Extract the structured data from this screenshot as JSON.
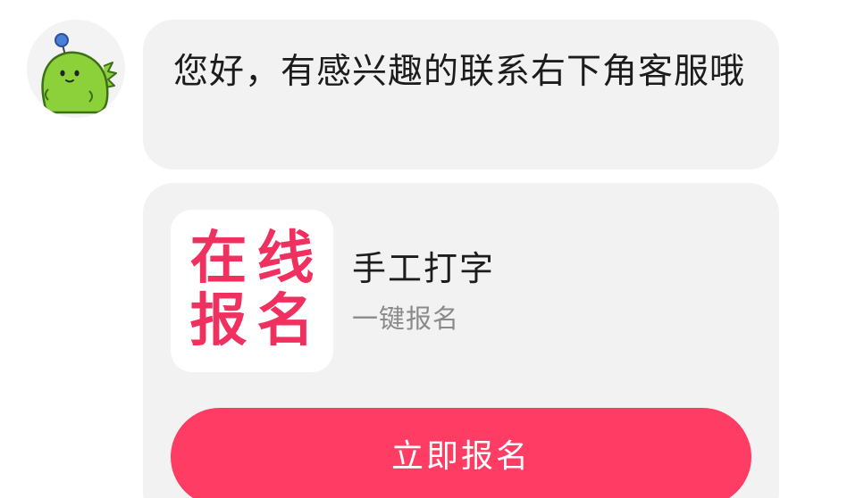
{
  "message": {
    "text": "您好，有感兴趣的联系右下角客服哦"
  },
  "card": {
    "logo_chars": [
      "在",
      "线",
      "报",
      "名"
    ],
    "title": "手工打字",
    "subtitle": "一键报名",
    "button_label": "立即报名"
  },
  "colors": {
    "accent": "#ff3d64",
    "logo_red": "#f0305f",
    "bubble_bg": "#f2f2f2",
    "avatar_green": "#8cd13a"
  },
  "icons": {
    "avatar": "green-dinosaur-avatar-icon"
  }
}
